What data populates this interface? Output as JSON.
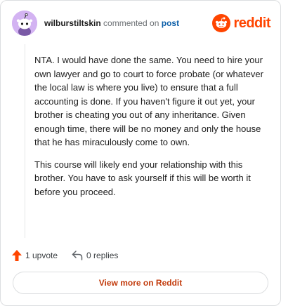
{
  "header": {
    "username": "wilburstiltskin",
    "verb": "commented on",
    "post_link": "post",
    "brand": "reddit"
  },
  "comment": {
    "paragraphs": [
      "NTA. I would have done the same. You need to hire your own lawyer and go to court to force probate (or whatever the local law is where you live) to ensure that a full accounting is done. If you haven't figure it out yet, your brother is cheating you out of any inheritance. Given enough time, there will be no money and only the house that he has miraculously come to own.",
      "This course will likely end your relationship with this brother. You have to ask yourself if this will be worth it before you proceed."
    ]
  },
  "actions": {
    "upvotes": "1 upvote",
    "replies": "0 replies"
  },
  "footer": {
    "view_more": "View more on Reddit"
  },
  "icons": {
    "avatar": "snoo-avatar-icon",
    "brand": "reddit-logo-icon",
    "upvote": "upvote-arrow-icon",
    "reply": "reply-arrow-icon"
  },
  "colors": {
    "brand": "#ff4500",
    "link": "#0b5ea8",
    "view_more": "#c23b0c",
    "avatar_bg": "#d3b3f2"
  }
}
